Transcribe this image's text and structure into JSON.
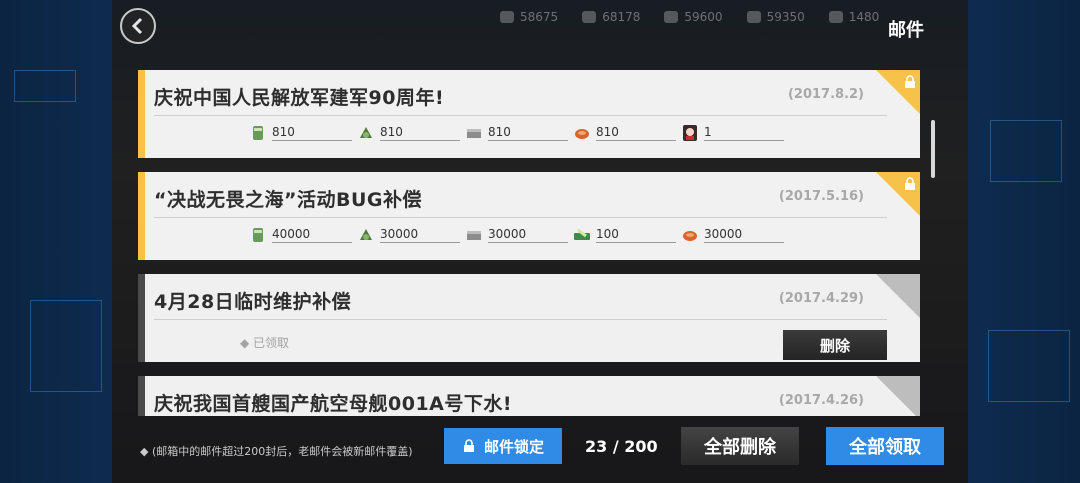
{
  "header": {
    "title": "邮件",
    "resources": [
      "58675",
      "68178",
      "59600",
      "59350",
      "1480"
    ]
  },
  "mails": [
    {
      "subject": "庆祝中国人民解放军建军90周年!",
      "date": "(2017.8.2)",
      "status": "unread",
      "rewards": [
        {
          "icon": "ammo-icon",
          "value": "810"
        },
        {
          "icon": "ration-icon",
          "value": "810"
        },
        {
          "icon": "parts-icon",
          "value": "810"
        },
        {
          "icon": "contract-icon",
          "value": "810"
        },
        {
          "icon": "doll-avatar-icon",
          "value": "1"
        }
      ]
    },
    {
      "subject": "“决战无畏之海”活动BUG补偿",
      "date": "(2017.5.16)",
      "status": "unread",
      "rewards": [
        {
          "icon": "ammo-icon",
          "value": "40000"
        },
        {
          "icon": "ration-icon",
          "value": "30000"
        },
        {
          "icon": "parts-icon",
          "value": "30000"
        },
        {
          "icon": "quick-repair-icon",
          "value": "100"
        },
        {
          "icon": "contract-icon",
          "value": "30000"
        }
      ]
    },
    {
      "subject": "4月28日临时维护补偿",
      "date": "(2017.4.29)",
      "status": "read",
      "claimed_label": "已领取",
      "delete_label": "删除"
    },
    {
      "subject": "庆祝我国首艘国产航空母舰001A号下水!",
      "date": "(2017.4.26)",
      "status": "read"
    }
  ],
  "footer": {
    "note": "(邮箱中的邮件超过200封后，老邮件会被新邮件覆盖)",
    "lock_label": "邮件锁定",
    "page_count": "23 / 200",
    "delete_all_label": "全部删除",
    "claim_all_label": "全部领取"
  },
  "colors": {
    "accent_blue": "#2f8be6",
    "unread_stripe": "#f6c24a",
    "card_bg": "#f1f1f1"
  }
}
